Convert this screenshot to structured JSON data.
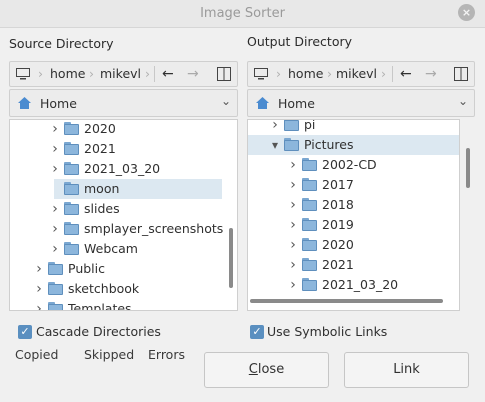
{
  "window": {
    "title": "Image Sorter"
  },
  "source": {
    "label": "Source Directory",
    "path": [
      "home",
      "mikevl"
    ],
    "location": "Home",
    "tree": [
      {
        "name": "2020",
        "arrow": "closed",
        "indent": 1
      },
      {
        "name": "2021",
        "arrow": "closed",
        "indent": 1
      },
      {
        "name": "2021_03_20",
        "arrow": "closed",
        "indent": 1
      },
      {
        "name": "moon",
        "arrow": "none",
        "indent": 1,
        "selected": true
      },
      {
        "name": "slides",
        "arrow": "closed",
        "indent": 1
      },
      {
        "name": "smplayer_screenshots",
        "arrow": "closed",
        "indent": 1
      },
      {
        "name": "Webcam",
        "arrow": "closed",
        "indent": 1
      },
      {
        "name": "Public",
        "arrow": "closed",
        "indent": 0
      },
      {
        "name": "sketchbook",
        "arrow": "closed",
        "indent": 0
      },
      {
        "name": "Templates",
        "arrow": "closed",
        "indent": 0
      }
    ]
  },
  "output": {
    "label": "Output Directory",
    "path": [
      "home",
      "mikevl"
    ],
    "location": "Home",
    "tree": [
      {
        "name": "pi",
        "arrow": "closed",
        "indent": 0
      },
      {
        "name": "Pictures",
        "arrow": "open",
        "indent": 0,
        "selected": true
      },
      {
        "name": "2002-CD",
        "arrow": "closed",
        "indent": 1
      },
      {
        "name": "2017",
        "arrow": "closed",
        "indent": 1
      },
      {
        "name": "2018",
        "arrow": "closed",
        "indent": 1
      },
      {
        "name": "2019",
        "arrow": "closed",
        "indent": 1
      },
      {
        "name": "2020",
        "arrow": "closed",
        "indent": 1
      },
      {
        "name": "2021",
        "arrow": "closed",
        "indent": 1
      },
      {
        "name": "2021_03_20",
        "arrow": "closed",
        "indent": 1
      }
    ]
  },
  "options": {
    "cascade": {
      "label": "Cascade Directories",
      "checked": true
    },
    "symlinks": {
      "label": "Use Symbolic Links",
      "checked": true
    }
  },
  "stats": {
    "copied": "Copied",
    "skipped": "Skipped",
    "errors": "Errors"
  },
  "buttons": {
    "close_first": "C",
    "close_rest": "lose",
    "link": "Link"
  },
  "icons": {
    "computer": "computer-icon",
    "back": "arrow-left-icon",
    "forward": "arrow-right-icon",
    "panes": "split-pane-icon",
    "home": "home-icon",
    "folder": "folder-icon"
  }
}
